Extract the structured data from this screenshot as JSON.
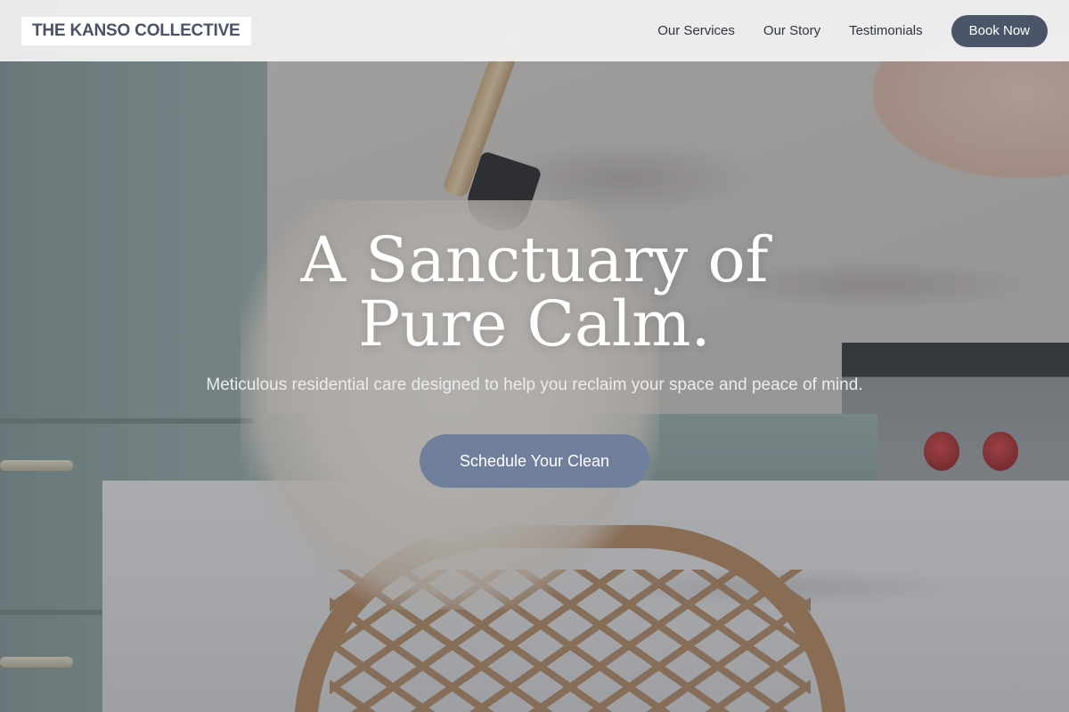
{
  "header": {
    "logo_text": "THE KANSO COLLECTIVE",
    "nav": [
      {
        "label": "Our Services"
      },
      {
        "label": "Our Story"
      },
      {
        "label": "Testimonials"
      }
    ],
    "book_label": "Book Now"
  },
  "hero": {
    "headline_line1": "A Sanctuary of",
    "headline_line2": "Pure Calm.",
    "subheadline": "Meticulous residential care designed to help you reclaim your space and peace of mind.",
    "cta_label": "Schedule Your Clean"
  },
  "colors": {
    "book_button": "#4b5568",
    "cta_button": "#6f7f9c",
    "logo_text": "#4a5263"
  }
}
